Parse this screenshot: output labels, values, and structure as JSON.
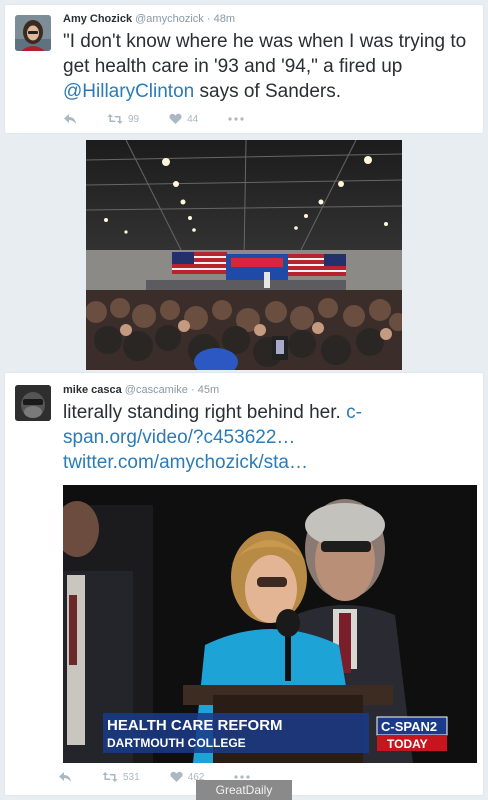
{
  "tweets": [
    {
      "author_name": "Amy Chozick",
      "author_handle": "@amychozick",
      "separator": "·",
      "time": "48m",
      "text_before_link": "\"I don't know where he was when I was trying to get health care in '93 and '94,\" a fired up ",
      "mention": "@HillaryClinton",
      "text_after_link": " says of Sanders.",
      "retweets": "99",
      "likes": "44",
      "photo_alt": "Hillary Clinton speaking at a rally in a large warehouse crowd"
    },
    {
      "author_name": "mike casca",
      "author_handle": "@cascamike",
      "separator": "·",
      "time": "45m",
      "text": "literally standing right behind her. ",
      "link1": "c-span.org/video/?c453622…",
      "link2": "twitter.com/amychozick/sta…",
      "retweets": "531",
      "likes": "462",
      "video_caption_line1": "HEALTH CARE REFORM",
      "video_caption_line2": "DARTMOUTH COLLEGE",
      "network_logo": "C-SPAN2",
      "network_tag": "TODAY"
    }
  ],
  "watermark": "GreatDaily",
  "colors": {
    "link": "#2b7bb9",
    "text": "#292f33",
    "muted": "#8899a6",
    "cspan_blue": "#1a3b8a",
    "cspan_red": "#c4161c"
  }
}
